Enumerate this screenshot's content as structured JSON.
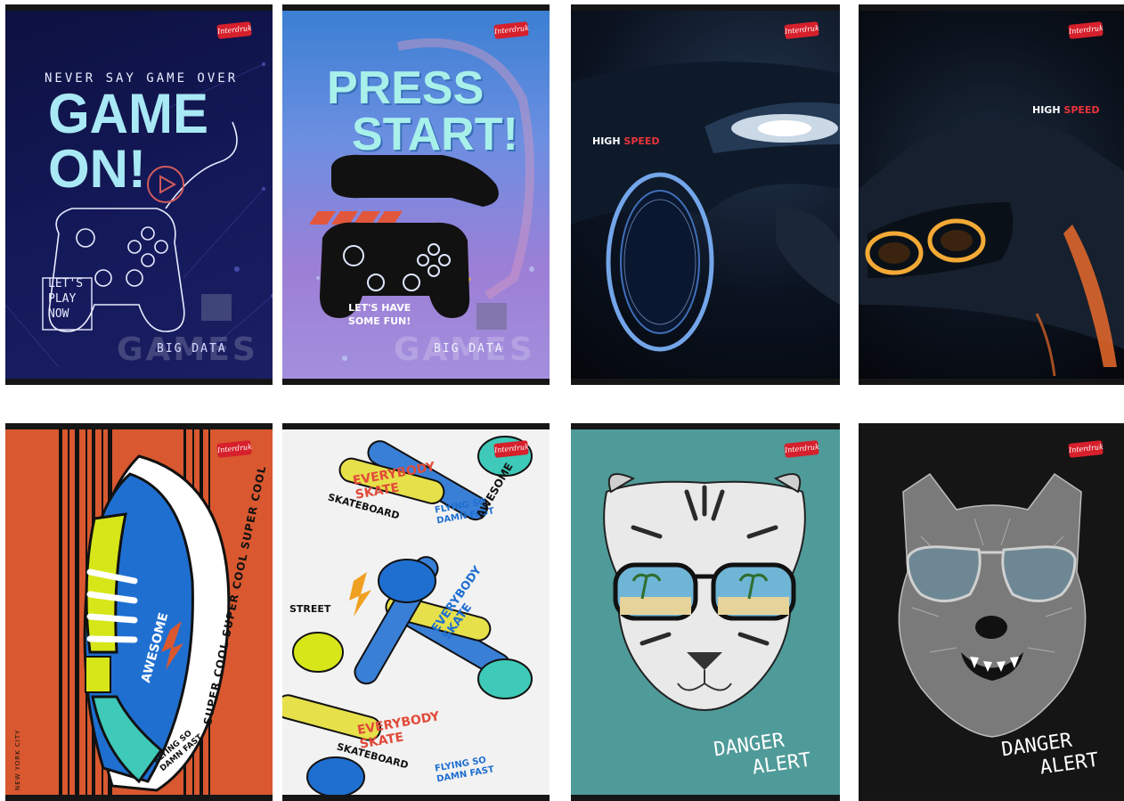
{
  "brand_logo_text": "Interdruk",
  "covers": [
    {
      "name": "game-on",
      "texts": {
        "tagline": "NEVER SAY GAME OVER",
        "line1": "GAME",
        "line2": "ON!",
        "play1": "LET'S",
        "play2": "PLAY",
        "play3": "NOW",
        "bigdata": "BIG DATA",
        "watermark": "GAMES"
      }
    },
    {
      "name": "press-start",
      "texts": {
        "line1": "PRESS",
        "line2": "START!",
        "fun1": "LET'S HAVE",
        "fun2": "SOME FUN!",
        "bigdata": "BIG DATA",
        "watermark": "GAMES"
      }
    },
    {
      "name": "high-speed-1",
      "texts": {
        "high": "HIGH",
        "speed": "SPEED"
      }
    },
    {
      "name": "high-speed-2",
      "texts": {
        "high": "HIGH",
        "speed": "SPEED"
      }
    },
    {
      "name": "sneaker",
      "texts": {
        "ring": "SUPER COOL SUPER COOL SUPER COOL",
        "awesome": "AWESOME",
        "flying1": "FLYING SO",
        "flying2": "DAMN FAST",
        "city": "NEW YORK CITY"
      }
    },
    {
      "name": "skate-pattern",
      "texts": {
        "everybody": "EVERYBODY",
        "skate": "SKATE",
        "skateboard": "SKATEBOARD",
        "flying1": "FLYING SO",
        "flying2": "DAMN FAST",
        "awesome": "AWESOME",
        "street": "STREET"
      }
    },
    {
      "name": "tiger",
      "texts": {
        "danger": "DANGER",
        "alert": "ALERT"
      }
    },
    {
      "name": "wolf",
      "texts": {
        "danger": "DANGER",
        "alert": "ALERT"
      }
    }
  ],
  "colors": {
    "brand_red": "#d6202c",
    "neon_cyan": "#8fe3f0",
    "speed_red": "#e8343a",
    "sneaker_orange": "#d9582f",
    "tiger_teal": "#4f9b99"
  }
}
